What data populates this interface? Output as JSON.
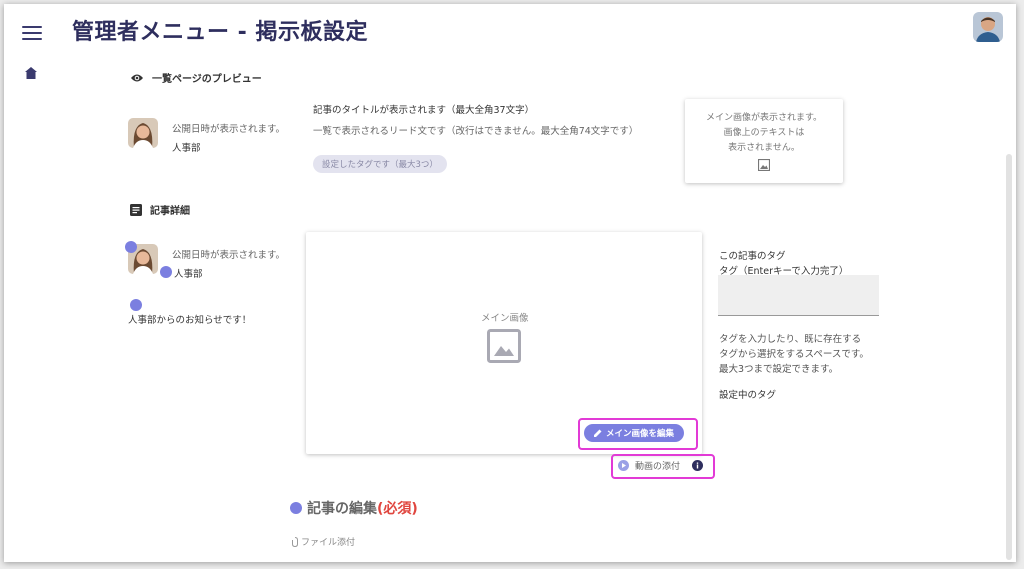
{
  "header": {
    "title": "管理者メニュー - 掲示板設定"
  },
  "preview": {
    "section_title": "一覧ページのプレビュー",
    "publish_date": "公開日時が表示されます。",
    "department": "人事部",
    "article_title": "記事のタイトルが表示されます（最大全角37文字）",
    "lead_text": "一覧で表示されるリード文です（改行はできません。最大全角74文字です）",
    "tag_pill": "設定したタグです（最大3つ）",
    "image_card_lines": [
      "メイン画像が表示されます。",
      "画像上のテキストは",
      "表示されません。"
    ]
  },
  "detail": {
    "section_title": "記事詳細",
    "publish_date": "公開日時が表示されます。",
    "department": "人事部",
    "notice": "人事部からのお知らせです！",
    "main_image_label": "メイン画像",
    "edit_image_button": "メイン画像を編集",
    "video_attach": "動画の添付",
    "tags_title": "この記事のタグ",
    "tag_input_label": "タグ（Enterキーで入力完了）",
    "tag_help_lines": [
      "タグを入力したり、既に存在する",
      "タグから選択をするスペースです。",
      "最大3つまで設定できます。"
    ],
    "current_tags_label": "設定中のタグ"
  },
  "edit": {
    "heading": "記事の編集",
    "required": "(必須)",
    "file_attach": "ファイル添付"
  },
  "colors": {
    "accent": "#7b7fe0",
    "title": "#2e2e5e",
    "highlight": "#e23ad6",
    "required": "#e0463f"
  }
}
